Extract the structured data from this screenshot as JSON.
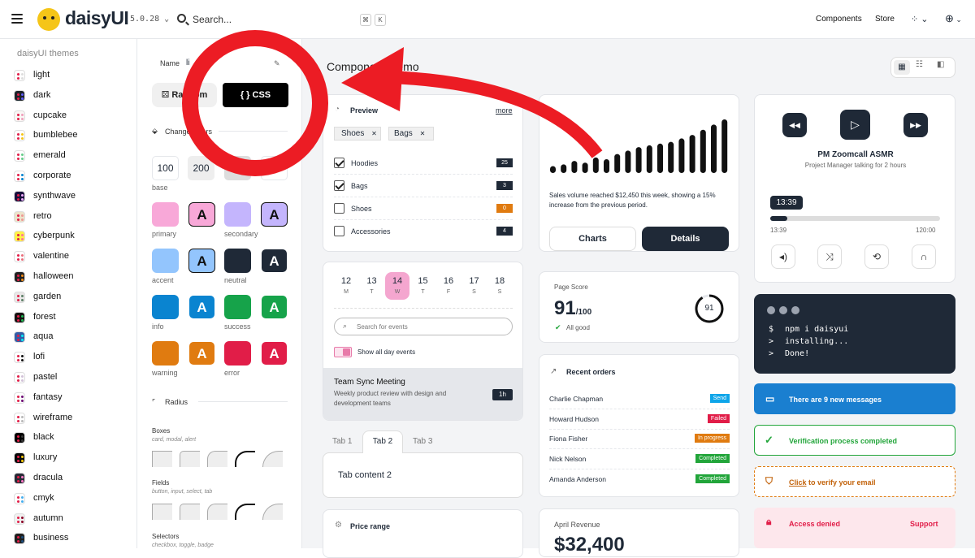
{
  "app": {
    "name": "daisyUI",
    "version": "5.0.28",
    "search_placeholder": "Search...",
    "kbd": [
      "⌘",
      "K"
    ],
    "nav": [
      "Components",
      "Store"
    ]
  },
  "colors": {
    "accent": "#e11d48",
    "primary": "#111827"
  },
  "themes": {
    "heading": "daisyUI themes",
    "items": [
      "light",
      "dark",
      "cupcake",
      "bumblebee",
      "emerald",
      "corporate",
      "synthwave",
      "retro",
      "cyberpunk",
      "valentine",
      "halloween",
      "garden",
      "forest",
      "aqua",
      "lofi",
      "pastel",
      "fantasy",
      "wireframe",
      "black",
      "luxury",
      "dracula",
      "cmyk",
      "autumn",
      "business"
    ]
  },
  "generator": {
    "name_label": "Name",
    "name_value": "li",
    "random_label": "Random",
    "css_label": "{ } CSS",
    "change_colors": "Change colors",
    "radius_heading": "Radius",
    "base_values": [
      "100",
      "200"
    ],
    "base_label": "base",
    "swatch_labels": [
      "primary",
      "secondary",
      "accent",
      "neutral",
      "info",
      "success",
      "warning",
      "error"
    ],
    "boxes_label": "Boxes",
    "boxes_hint": "card, modal, alert",
    "fields_label": "Fields",
    "fields_hint": "button, input, select, tab",
    "selectors_label": "Selectors",
    "selectors_hint": "checkbox, toggle, badge"
  },
  "page": {
    "title": "Component Demo"
  },
  "preview": {
    "title": "Preview",
    "more": "more",
    "chips": [
      "Shoes",
      "Bags"
    ],
    "items": [
      {
        "label": "Hoodies",
        "count": "25",
        "checked": true
      },
      {
        "label": "Bags",
        "count": "3",
        "checked": true
      },
      {
        "label": "Shoes",
        "count": "0",
        "checked": false
      },
      {
        "label": "Accessories",
        "count": "4",
        "checked": false
      }
    ]
  },
  "sales": {
    "bars": [
      8,
      10,
      14,
      12,
      18,
      16,
      22,
      26,
      30,
      32,
      34,
      36,
      40,
      44,
      50,
      56,
      62
    ],
    "text": "Sales volume reached $12,450 this week, showing a 15% increase from the previous period.",
    "charts_btn": "Charts",
    "details_btn": "Details"
  },
  "calendar": {
    "days": [
      {
        "n": "12",
        "d": "M"
      },
      {
        "n": "13",
        "d": "T"
      },
      {
        "n": "14",
        "d": "W"
      },
      {
        "n": "15",
        "d": "T"
      },
      {
        "n": "16",
        "d": "F"
      },
      {
        "n": "17",
        "d": "S"
      },
      {
        "n": "18",
        "d": "S"
      }
    ],
    "search_placeholder": "Search for events",
    "all_day": "Show all day events",
    "event_title": "Team Sync Meeting",
    "event_desc": "Weekly product review with design and development teams",
    "event_dur": "1h"
  },
  "tabs": {
    "labels": [
      "Tab 1",
      "Tab 2",
      "Tab 3"
    ],
    "content": "Tab content 2"
  },
  "price": {
    "title": "Price range"
  },
  "score": {
    "label": "Page Score",
    "value": "91",
    "of": "/100",
    "ring": "91",
    "status": "All good"
  },
  "orders": {
    "title": "Recent orders",
    "rows": [
      {
        "name": "Charlie Chapman",
        "status": "Send",
        "color": "#0ea5e9"
      },
      {
        "name": "Howard Hudson",
        "status": "Failed",
        "color": "#e11d48"
      },
      {
        "name": "Fiona Fisher",
        "status": "In progress",
        "color": "#e07b10"
      },
      {
        "name": "Nick Nelson",
        "status": "Completed",
        "color": "#22a53a"
      },
      {
        "name": "Amanda Anderson",
        "status": "Completed",
        "color": "#22a53a"
      }
    ]
  },
  "revenue": {
    "label": "April Revenue",
    "value": "$32,400"
  },
  "player": {
    "title": "PM Zoomcall ASMR",
    "subtitle": "Project Manager talking for 2 hours",
    "time": "13:39",
    "start": "13:39",
    "end": "120:00",
    "progress": 0.1
  },
  "terminal": {
    "lines": [
      {
        "p": "$",
        "t": "npm i daisyui"
      },
      {
        "p": ">",
        "t": "installing..."
      },
      {
        "p": ">",
        "t": "Done!"
      }
    ]
  },
  "alerts": {
    "info": "There are 9 new messages",
    "success": "Verification process completed",
    "warn_link": "Click",
    "warn_rest": " to verify your email",
    "error": "Access denied",
    "error_action": "Support"
  }
}
